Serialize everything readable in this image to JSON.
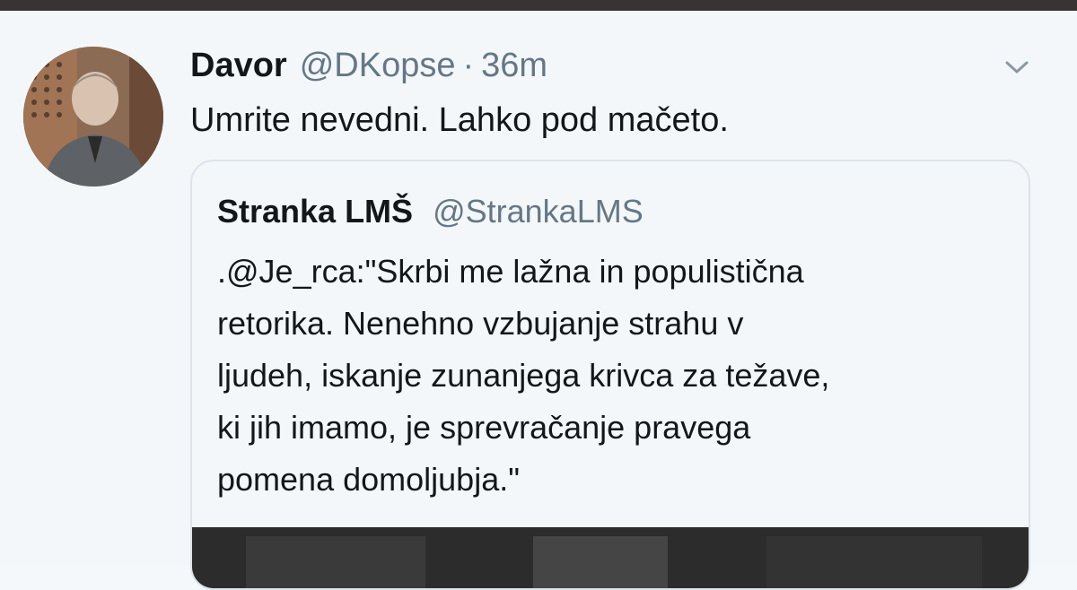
{
  "tweet": {
    "author_name": "Davor",
    "handle": "@DKopse",
    "separator": "·",
    "time": "36m",
    "text": "Umrite nevedni. Lahko pod mačeto.",
    "caret_icon": "chevron-down-icon"
  },
  "quoted_tweet": {
    "author_name": "Stranka LMŠ",
    "handle": "@StrankaLMS",
    "text_lines": [
      ".@Je_rca:\"Skrbi me lažna in populistična",
      "retorika. Nenehno vzbujanje strahu v",
      "ljudeh, iskanje zunanjega krivca za težave,",
      "ki jih imamo, je sprevračanje pravega",
      "pomena domoljubja.\""
    ]
  },
  "colors": {
    "background": "#f4f7fa",
    "top_bar": "#3a3333",
    "text_primary": "#14171a",
    "text_secondary": "#657786",
    "border": "#dce3ea"
  }
}
